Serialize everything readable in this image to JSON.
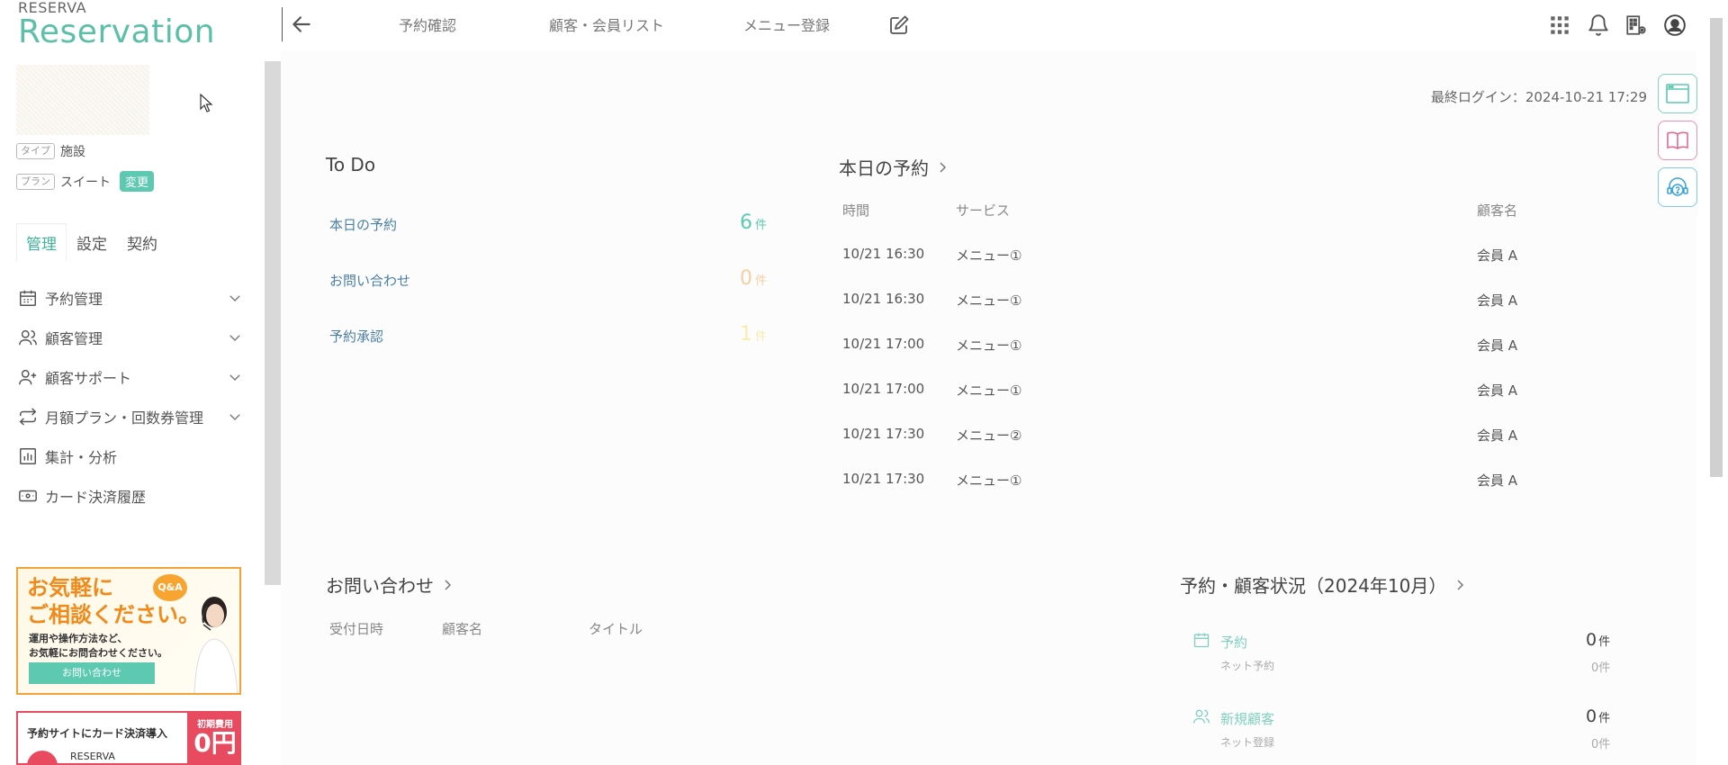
{
  "header": {
    "logo_top": "RESERVA",
    "logo_main": "Reservation",
    "nav": [
      "予約確認",
      "顧客・会員リスト",
      "メニュー登録"
    ]
  },
  "sidebar": {
    "type_tag": "タイプ",
    "type_value": "施設",
    "plan_tag": "プラン",
    "plan_value": "スイート",
    "plan_change": "変更",
    "tabs": [
      "管理",
      "設定",
      "契約"
    ],
    "menu": [
      {
        "label": "予約管理",
        "icon": "calendar-icon",
        "expandable": true
      },
      {
        "label": "顧客管理",
        "icon": "users-icon",
        "expandable": true
      },
      {
        "label": "顧客サポート",
        "icon": "user-plus-icon",
        "expandable": true
      },
      {
        "label": "月額プラン・回数券管理",
        "icon": "repeat-icon",
        "expandable": true
      },
      {
        "label": "集計・分析",
        "icon": "bar-chart-icon",
        "expandable": false
      },
      {
        "label": "カード決済履歴",
        "icon": "card-icon",
        "expandable": false
      }
    ],
    "banner_support": {
      "title_line1": "お気軽に",
      "title_line2": "ご相談ください。",
      "qa": "Q&A",
      "sub_line1": "運用や操作方法など、",
      "sub_line2": "お気軽にお問合わせください。",
      "button": "お問い合わせ"
    },
    "banner_card": {
      "text": "予約サイトにカード決済導入",
      "brand": "RESERVA",
      "price_label": "初期費用",
      "price_value": "0円"
    }
  },
  "main": {
    "last_login": "最終ログイン：2024-10-21 17:29",
    "todo": {
      "title": "To Do",
      "items": [
        {
          "label": "本日の予約",
          "count": "6",
          "unit": "件",
          "color": "#5cc9b0"
        },
        {
          "label": "お問い合わせ",
          "count": "0",
          "unit": "件",
          "color": "#f5cfa0"
        },
        {
          "label": "予約承認",
          "count": "1",
          "unit": "件",
          "color": "#f8ecb0"
        }
      ]
    },
    "today_reservations": {
      "title": "本日の予約",
      "headers": [
        "時間",
        "サービス",
        "顧客名"
      ],
      "rows": [
        [
          "10/21 16:30",
          "メニュー①",
          "会員 A"
        ],
        [
          "10/21 16:30",
          "メニュー①",
          "会員 A"
        ],
        [
          "10/21 17:00",
          "メニュー①",
          "会員 A"
        ],
        [
          "10/21 17:00",
          "メニュー①",
          "会員 A"
        ],
        [
          "10/21 17:30",
          "メニュー②",
          "会員 A"
        ],
        [
          "10/21 17:30",
          "メニュー①",
          "会員 A"
        ]
      ]
    },
    "inquiries": {
      "title": "お問い合わせ",
      "headers": [
        "受付日時",
        "顧客名",
        "タイトル"
      ]
    },
    "status": {
      "title": "予約・顧客状況（2024年10月）",
      "items": [
        {
          "label": "予約",
          "sub": "ネット予約",
          "count": "0",
          "unit": "件",
          "sub_count": "0件",
          "icon": "calendar-icon"
        },
        {
          "label": "新規顧客",
          "sub": "ネット登録",
          "count": "0",
          "unit": "件",
          "sub_count": "0件",
          "icon": "users-icon"
        }
      ]
    }
  }
}
